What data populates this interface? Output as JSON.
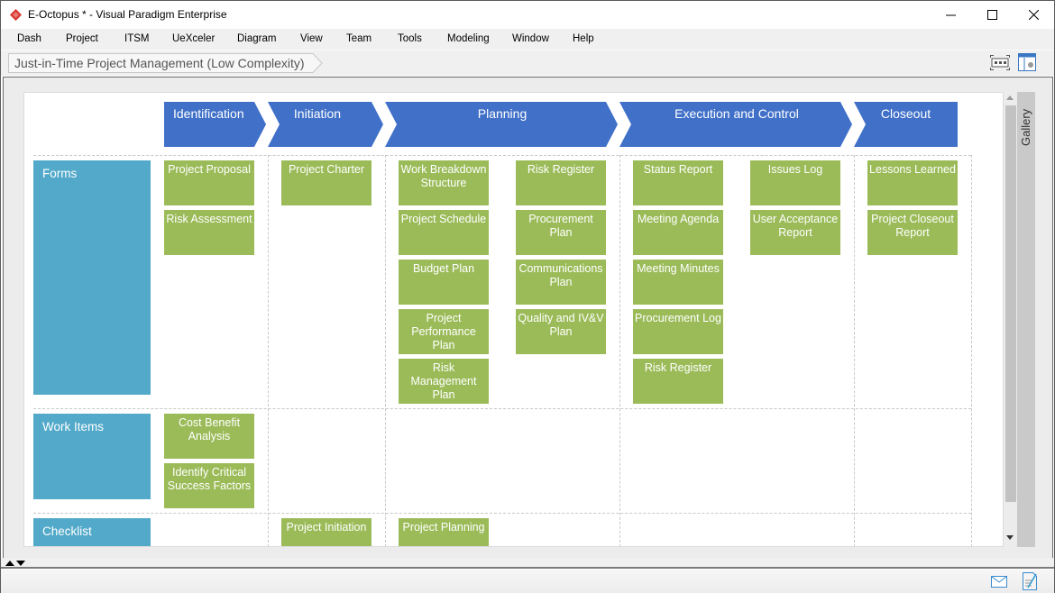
{
  "window": {
    "title": "E-Octopus * - Visual Paradigm Enterprise",
    "controls": [
      "minimize",
      "maximize",
      "close"
    ]
  },
  "menu": [
    "Dash",
    "Project",
    "ITSM",
    "UeXceler",
    "Diagram",
    "View",
    "Team",
    "Tools",
    "Modeling",
    "Window",
    "Help"
  ],
  "breadcrumb": "Just-in-Time Project Management (Low Complexity)",
  "toolbar_icons": [
    "fit-diagram-icon",
    "layout-panel-icon"
  ],
  "gallery_label": "Gallery",
  "colors": {
    "phase": "#4070c8",
    "lane": "#52a9c9",
    "card": "#9bbb59"
  },
  "phases": [
    "Identification",
    "Initiation",
    "Planning",
    "Execution and Control",
    "Closeout"
  ],
  "lanes": [
    {
      "name": "Forms",
      "cells": [
        [
          "Project Proposal",
          "Risk Assessment"
        ],
        [
          "Project Charter"
        ],
        [
          "Work Breakdown Structure",
          "Project Schedule",
          "Budget Plan",
          "Project Performance Plan",
          "Risk Management Plan"
        ],
        [
          "Risk Register",
          "Procurement Plan",
          "Communications Plan",
          "Quality and IV&V Plan"
        ],
        [
          "Status Report",
          "Meeting Agenda",
          "Meeting Minutes",
          "Procurement Log",
          "Risk Register"
        ],
        [
          "Issues Log",
          "User Acceptance Report"
        ],
        [
          "Lessons Learned",
          "Project Closeout Report"
        ]
      ]
    },
    {
      "name": "Work Items",
      "cells": [
        [
          "Cost Benefit Analysis",
          "Identify Critical Success Factors"
        ],
        [],
        [],
        [],
        [],
        [],
        []
      ]
    },
    {
      "name": "Checklist",
      "cells": [
        [],
        [
          "Project Initiation"
        ],
        [
          "Project Planning"
        ],
        [],
        [],
        [],
        []
      ]
    }
  ],
  "status_icons": [
    "mail-icon",
    "notes-icon"
  ]
}
